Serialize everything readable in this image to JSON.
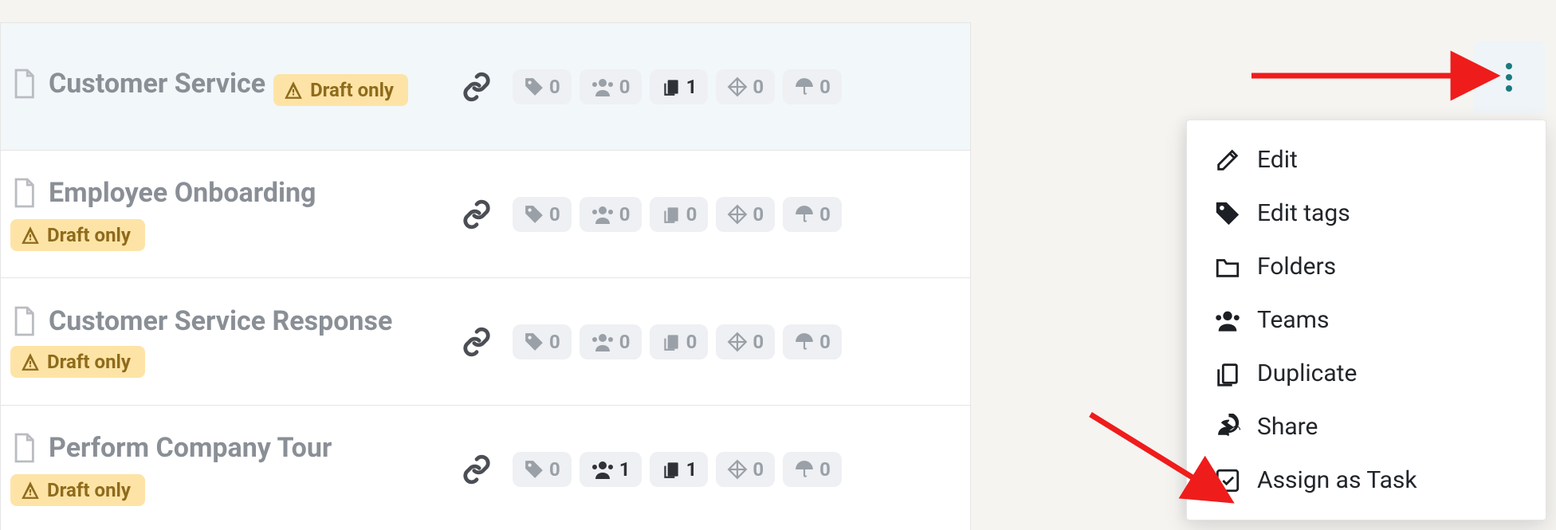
{
  "rows": [
    {
      "title": "Customer Service",
      "badge": "Draft only",
      "selected": true,
      "stats": {
        "tags": 0,
        "people": 0,
        "copies": 1,
        "diamond": 0,
        "umbrella": 0
      },
      "active_stats": [
        "copies"
      ]
    },
    {
      "title": "Employee Onboarding",
      "badge": "Draft only",
      "selected": false,
      "stats": {
        "tags": 0,
        "people": 0,
        "copies": 0,
        "diamond": 0,
        "umbrella": 0
      },
      "active_stats": []
    },
    {
      "title": "Customer Service Response",
      "badge": "Draft only",
      "selected": false,
      "inline_badge": true,
      "stats": {
        "tags": 0,
        "people": 0,
        "copies": 0,
        "diamond": 0,
        "umbrella": 0
      },
      "active_stats": []
    },
    {
      "title": "Perform Company Tour",
      "badge": "Draft only",
      "selected": false,
      "stats": {
        "tags": 0,
        "people": 1,
        "copies": 1,
        "diamond": 0,
        "umbrella": 0
      },
      "active_stats": [
        "people",
        "copies"
      ]
    }
  ],
  "menu": {
    "edit": "Edit",
    "edit_tags": "Edit tags",
    "folders": "Folders",
    "teams": "Teams",
    "duplicate": "Duplicate",
    "share": "Share",
    "assign_as_task": "Assign as Task"
  }
}
